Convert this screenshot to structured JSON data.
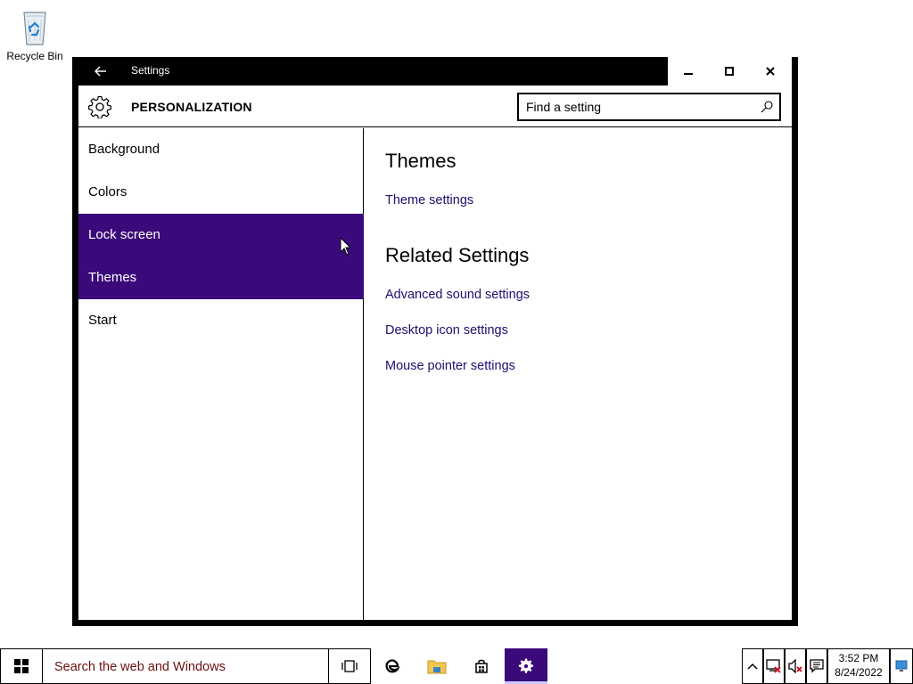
{
  "desktop": {
    "recycle_bin_label": "Recycle Bin"
  },
  "window": {
    "title": "Settings",
    "icons": {
      "back": "back-arrow-icon",
      "minimize": "minimize-icon",
      "maximize": "maximize-icon",
      "close": "close-icon"
    }
  },
  "header": {
    "page_title": "PERSONALIZATION",
    "icon": "gear-icon",
    "search_placeholder": "Find a setting"
  },
  "nav": {
    "items": [
      {
        "label": "Background",
        "selected": false
      },
      {
        "label": "Colors",
        "selected": false
      },
      {
        "label": "Lock screen",
        "selected": true
      },
      {
        "label": "Themes",
        "selected": true
      },
      {
        "label": "Start",
        "selected": false
      }
    ]
  },
  "content": {
    "themes_title": "Themes",
    "themes_link": "Theme settings",
    "related_title": "Related Settings",
    "related_links": [
      "Advanced sound settings",
      "Desktop icon settings",
      "Mouse pointer settings"
    ]
  },
  "taskbar": {
    "search_text": "Search the web and Windows",
    "time": "3:52 PM",
    "date": "8/24/2022"
  },
  "colors": {
    "accent": "#3a0a7b",
    "link": "#1a1070",
    "taskbar_search_text": "#6a0f0f"
  }
}
